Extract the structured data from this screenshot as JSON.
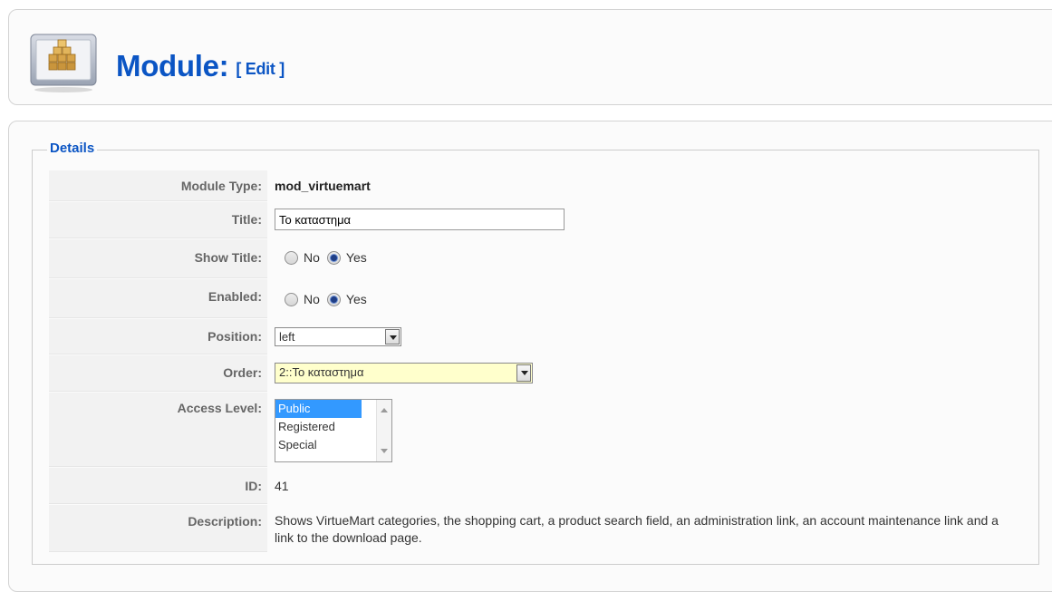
{
  "header": {
    "title": "Module:",
    "edit_label": "[ Edit ]"
  },
  "details": {
    "legend": "Details",
    "module_type": {
      "label": "Module Type:",
      "value": "mod_virtuemart"
    },
    "title": {
      "label": "Title:",
      "value": "Το καταστημα"
    },
    "show_title": {
      "label": "Show Title:",
      "options": [
        "No",
        "Yes"
      ],
      "selected": "Yes"
    },
    "enabled": {
      "label": "Enabled:",
      "options": [
        "No",
        "Yes"
      ],
      "selected": "Yes"
    },
    "position": {
      "label": "Position:",
      "value": "left"
    },
    "order": {
      "label": "Order:",
      "value": "2::Το καταστημα"
    },
    "access_level": {
      "label": "Access Level:",
      "options": [
        "Public",
        "Registered",
        "Special"
      ],
      "selected": "Public"
    },
    "id": {
      "label": "ID:",
      "value": "41"
    },
    "description": {
      "label": "Description:",
      "value": "Shows VirtueMart categories, the shopping cart, a product search field, an administration link, an account maintenance link and a link to the download page."
    }
  },
  "colors": {
    "accent": "#0b55c4",
    "key_background": "#f2f2f2",
    "selection": "#3399ff",
    "order_field_background": "#ffffcc"
  }
}
